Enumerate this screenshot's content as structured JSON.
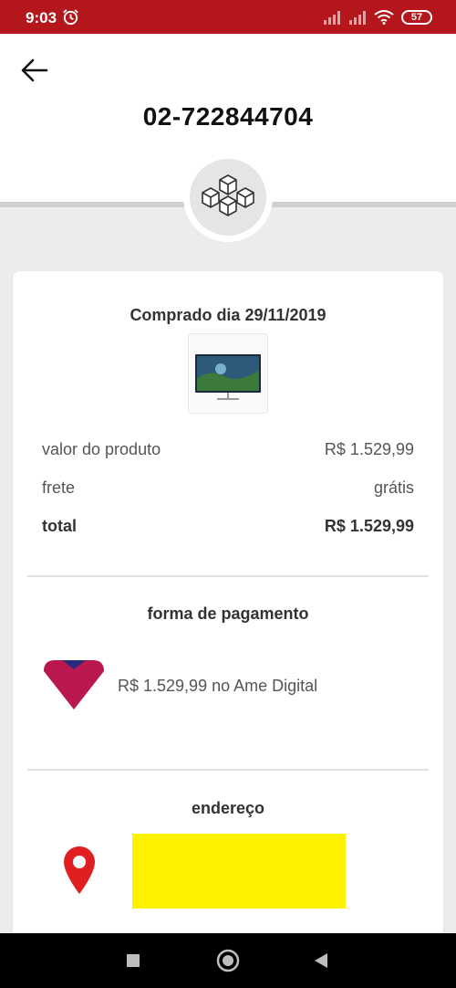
{
  "status_bar": {
    "time": "9:03",
    "battery": "57"
  },
  "header": {
    "order_number": "02-722844704"
  },
  "purchase": {
    "title": "Comprado dia 29/11/2019",
    "rows": [
      {
        "label": "valor do produto",
        "value": "R$ 1.529,99"
      },
      {
        "label": "frete",
        "value": "grátis"
      },
      {
        "label": "total",
        "value": "R$ 1.529,99"
      }
    ]
  },
  "payment": {
    "title": "forma de pagamento",
    "text": "R$ 1.529,99 no Ame Digital"
  },
  "address": {
    "title": "endereço"
  },
  "colors": {
    "status_bar": "#b3161b",
    "pin": "#e02020",
    "address_highlight": "#fff200",
    "ame_logo": "#b8174f"
  }
}
